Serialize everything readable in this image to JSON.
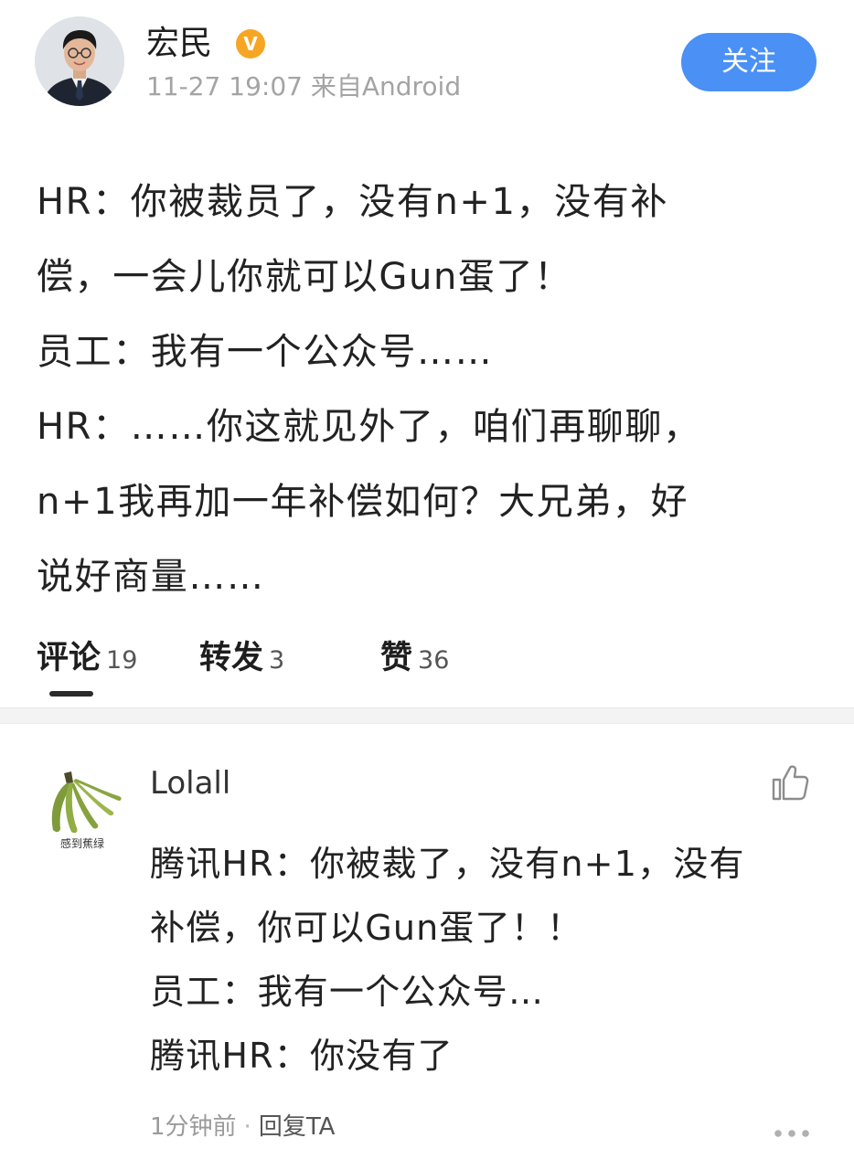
{
  "post": {
    "author": "宏民",
    "verified_badge": "V",
    "meta": "11-27 19:07 来自Android",
    "follow_label": "关注",
    "lines": [
      "HR：你被裁员了，没有n+1，没有补",
      "偿，一会儿你就可以Gun蛋了！",
      "员工：我有一个公众号……",
      "HR：……你这就见外了，咱们再聊聊，",
      "n+1我再加一年补偿如何？大兄弟，好",
      "说好商量……"
    ]
  },
  "tabs": {
    "comments": {
      "label": "评论",
      "count": "19"
    },
    "reposts": {
      "label": "转发",
      "count": "3"
    },
    "likes": {
      "label": "赞",
      "count": "36"
    }
  },
  "comment": {
    "author": "Lolall",
    "avatar_caption": "感到蕉绿",
    "lines": [
      "腾讯HR：你被裁了，没有n+1，没有",
      "补偿，你可以Gun蛋了！！",
      "员工：我有一个公众号…",
      "腾讯HR：你没有了"
    ],
    "time": "1分钟前",
    "separator": "·",
    "reply_label": "回复TA"
  },
  "icons": {
    "verified": "verified-badge-icon",
    "like": "thumbs-up-icon",
    "more": "more-dots-icon"
  },
  "colors": {
    "follow_button": "#4a90f5",
    "verified_badge": "#f6a623",
    "meta_text": "#a4a4a4"
  }
}
